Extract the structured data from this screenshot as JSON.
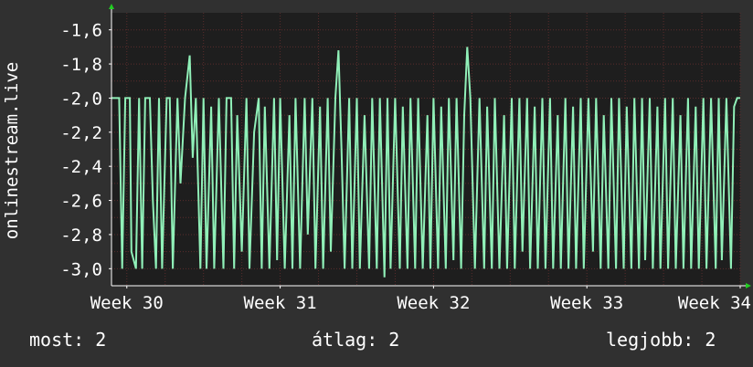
{
  "chart_data": {
    "type": "line",
    "ylabel": "onlinestream.live",
    "title": "",
    "xlabel": "",
    "x_ticks": [
      "Week 30",
      "Week 31",
      "Week 32",
      "Week 33",
      "Week 34"
    ],
    "y_ticks": [
      "-1,6",
      "-1,8",
      "-2,0",
      "-2,2",
      "-2,4",
      "-2,6",
      "-2,8",
      "-3,0"
    ],
    "y_tick_values": [
      -1.6,
      -1.8,
      -2.0,
      -2.2,
      -2.4,
      -2.6,
      -2.8,
      -3.0
    ],
    "ylim": [
      -3.1,
      -1.5
    ],
    "xlim": [
      29.9,
      34.0
    ],
    "grid": true,
    "colors": {
      "background": "#303030",
      "plot_area": "#1e1e1e",
      "line": "#90f0b8",
      "grid": "#5a2c2c",
      "axis": "#ffffff",
      "arrow": "#22cc22"
    },
    "series": [
      {
        "values": [
          [
            29.9,
            -2.0
          ],
          [
            29.95,
            -2.0
          ],
          [
            29.97,
            -3.0
          ],
          [
            29.99,
            -2.0
          ],
          [
            30.02,
            -2.0
          ],
          [
            30.03,
            -2.9
          ],
          [
            30.06,
            -3.0
          ],
          [
            30.08,
            -2.0
          ],
          [
            30.1,
            -3.0
          ],
          [
            30.12,
            -2.0
          ],
          [
            30.15,
            -2.0
          ],
          [
            30.17,
            -2.6
          ],
          [
            30.19,
            -3.0
          ],
          [
            30.21,
            -2.0
          ],
          [
            30.23,
            -3.0
          ],
          [
            30.26,
            -2.0
          ],
          [
            30.28,
            -2.0
          ],
          [
            30.3,
            -3.0
          ],
          [
            30.33,
            -2.0
          ],
          [
            30.35,
            -2.5
          ],
          [
            30.38,
            -2.0
          ],
          [
            30.41,
            -1.75
          ],
          [
            30.43,
            -2.35
          ],
          [
            30.45,
            -2.0
          ],
          [
            30.48,
            -3.0
          ],
          [
            30.5,
            -2.0
          ],
          [
            30.52,
            -3.0
          ],
          [
            30.55,
            -2.05
          ],
          [
            30.57,
            -3.0
          ],
          [
            30.6,
            -2.0
          ],
          [
            30.63,
            -3.0
          ],
          [
            30.65,
            -2.0
          ],
          [
            30.68,
            -2.0
          ],
          [
            30.7,
            -3.0
          ],
          [
            30.72,
            -2.1
          ],
          [
            30.75,
            -2.9
          ],
          [
            30.78,
            -2.0
          ],
          [
            30.8,
            -3.0
          ],
          [
            30.83,
            -2.2
          ],
          [
            30.86,
            -2.0
          ],
          [
            30.88,
            -3.0
          ],
          [
            30.9,
            -2.05
          ],
          [
            30.93,
            -3.0
          ],
          [
            30.96,
            -2.0
          ],
          [
            30.98,
            -2.95
          ],
          [
            31.0,
            -2.0
          ],
          [
            31.03,
            -3.0
          ],
          [
            31.06,
            -2.1
          ],
          [
            31.08,
            -3.0
          ],
          [
            31.1,
            -2.0
          ],
          [
            31.13,
            -3.0
          ],
          [
            31.16,
            -2.0
          ],
          [
            31.18,
            -2.8
          ],
          [
            31.21,
            -2.0
          ],
          [
            31.23,
            -3.0
          ],
          [
            31.26,
            -2.05
          ],
          [
            31.28,
            -3.0
          ],
          [
            31.31,
            -2.0
          ],
          [
            31.33,
            -2.9
          ],
          [
            31.36,
            -2.0
          ],
          [
            31.38,
            -1.72
          ],
          [
            31.4,
            -2.3
          ],
          [
            31.42,
            -3.0
          ],
          [
            31.45,
            -2.0
          ],
          [
            31.47,
            -3.0
          ],
          [
            31.5,
            -2.0
          ],
          [
            31.52,
            -3.0
          ],
          [
            31.55,
            -2.1
          ],
          [
            31.58,
            -3.0
          ],
          [
            31.6,
            -2.0
          ],
          [
            31.63,
            -3.0
          ],
          [
            31.65,
            -2.0
          ],
          [
            31.68,
            -3.05
          ],
          [
            31.7,
            -2.0
          ],
          [
            31.72,
            -3.0
          ],
          [
            31.75,
            -2.0
          ],
          [
            31.78,
            -3.0
          ],
          [
            31.8,
            -2.05
          ],
          [
            31.83,
            -3.0
          ],
          [
            31.85,
            -2.0
          ],
          [
            31.88,
            -3.0
          ],
          [
            31.9,
            -2.0
          ],
          [
            31.93,
            -3.0
          ],
          [
            31.96,
            -2.1
          ],
          [
            31.98,
            -3.0
          ],
          [
            32.0,
            -2.0
          ],
          [
            32.03,
            -3.0
          ],
          [
            32.05,
            -2.05
          ],
          [
            32.08,
            -3.0
          ],
          [
            32.1,
            -2.0
          ],
          [
            32.13,
            -2.95
          ],
          [
            32.15,
            -2.0
          ],
          [
            32.18,
            -3.0
          ],
          [
            32.2,
            -2.1
          ],
          [
            32.22,
            -1.7
          ],
          [
            32.24,
            -2.0
          ],
          [
            32.27,
            -3.0
          ],
          [
            32.3,
            -2.0
          ],
          [
            32.33,
            -3.0
          ],
          [
            32.35,
            -2.05
          ],
          [
            32.38,
            -3.0
          ],
          [
            32.4,
            -2.0
          ],
          [
            32.43,
            -3.0
          ],
          [
            32.46,
            -2.1
          ],
          [
            32.48,
            -3.0
          ],
          [
            32.51,
            -2.0
          ],
          [
            32.53,
            -3.0
          ],
          [
            32.56,
            -2.0
          ],
          [
            32.58,
            -2.9
          ],
          [
            32.61,
            -2.0
          ],
          [
            32.63,
            -3.0
          ],
          [
            32.66,
            -2.05
          ],
          [
            32.68,
            -3.0
          ],
          [
            32.71,
            -2.0
          ],
          [
            32.73,
            -3.0
          ],
          [
            32.76,
            -2.0
          ],
          [
            32.78,
            -3.0
          ],
          [
            32.81,
            -2.1
          ],
          [
            32.83,
            -3.0
          ],
          [
            32.86,
            -2.0
          ],
          [
            32.88,
            -3.0
          ],
          [
            32.91,
            -2.05
          ],
          [
            32.93,
            -3.0
          ],
          [
            32.96,
            -2.0
          ],
          [
            32.98,
            -3.0
          ],
          [
            33.01,
            -2.0
          ],
          [
            33.04,
            -2.9
          ],
          [
            33.06,
            -2.0
          ],
          [
            33.09,
            -3.0
          ],
          [
            33.11,
            -2.1
          ],
          [
            33.14,
            -3.0
          ],
          [
            33.16,
            -2.0
          ],
          [
            33.19,
            -3.0
          ],
          [
            33.21,
            -2.0
          ],
          [
            33.24,
            -3.0
          ],
          [
            33.26,
            -2.05
          ],
          [
            33.29,
            -3.0
          ],
          [
            33.31,
            -2.0
          ],
          [
            33.34,
            -3.0
          ],
          [
            33.36,
            -2.0
          ],
          [
            33.38,
            -2.95
          ],
          [
            33.41,
            -2.0
          ],
          [
            33.43,
            -3.0
          ],
          [
            33.46,
            -2.05
          ],
          [
            33.48,
            -3.0
          ],
          [
            33.51,
            -2.0
          ],
          [
            33.53,
            -3.0
          ],
          [
            33.56,
            -2.0
          ],
          [
            33.58,
            -3.0
          ],
          [
            33.61,
            -2.1
          ],
          [
            33.63,
            -3.0
          ],
          [
            33.66,
            -2.0
          ],
          [
            33.68,
            -3.0
          ],
          [
            33.71,
            -2.05
          ],
          [
            33.73,
            -3.0
          ],
          [
            33.76,
            -2.0
          ],
          [
            33.78,
            -3.0
          ],
          [
            33.81,
            -2.0
          ],
          [
            33.84,
            -3.0
          ],
          [
            33.86,
            -2.0
          ],
          [
            33.88,
            -2.95
          ],
          [
            33.91,
            -2.0
          ],
          [
            33.94,
            -3.0
          ],
          [
            33.96,
            -2.05
          ],
          [
            33.98,
            -2.0
          ],
          [
            34.0,
            -2.0
          ]
        ]
      }
    ]
  },
  "stats": {
    "current": "most: 2",
    "average": "átlag: 2",
    "best": "legjobb: 2"
  }
}
